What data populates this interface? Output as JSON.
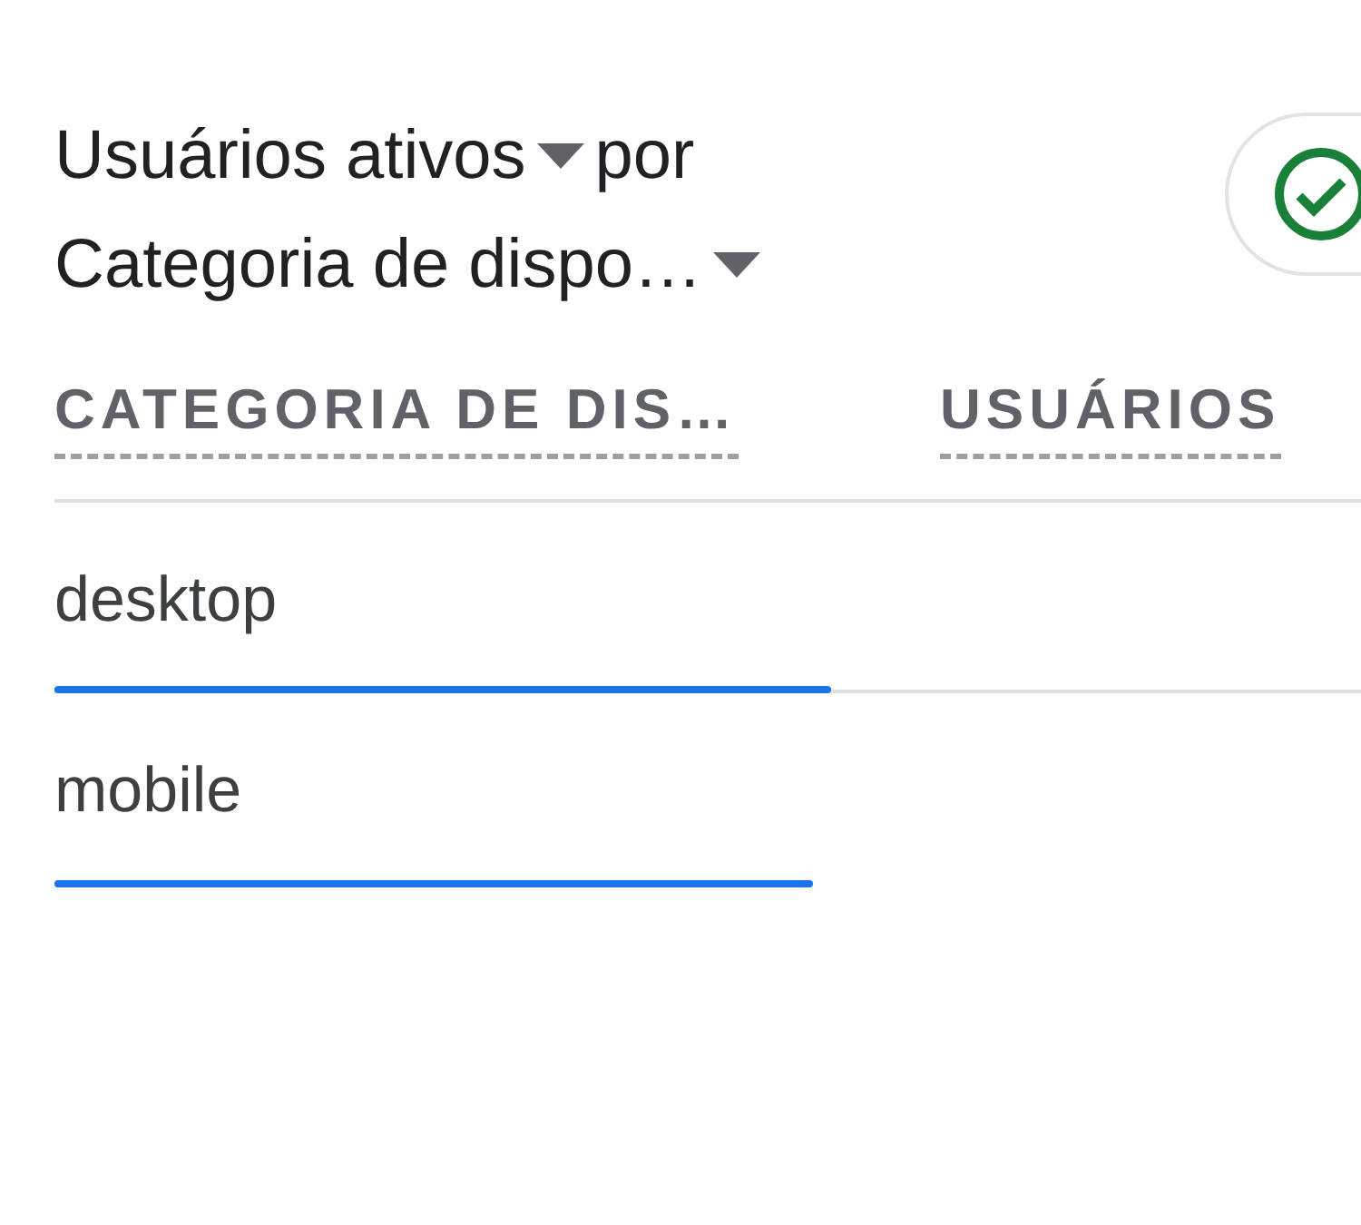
{
  "title": {
    "metric": "Usuários ativos",
    "connector": "por",
    "dimension": "Categoria de dispo…"
  },
  "table": {
    "columns": [
      {
        "label": "CATEGORIA DE DIS…"
      },
      {
        "label": "USUÁRIOS"
      }
    ],
    "rows": [
      {
        "label": "desktop"
      },
      {
        "label": "mobile"
      }
    ]
  }
}
